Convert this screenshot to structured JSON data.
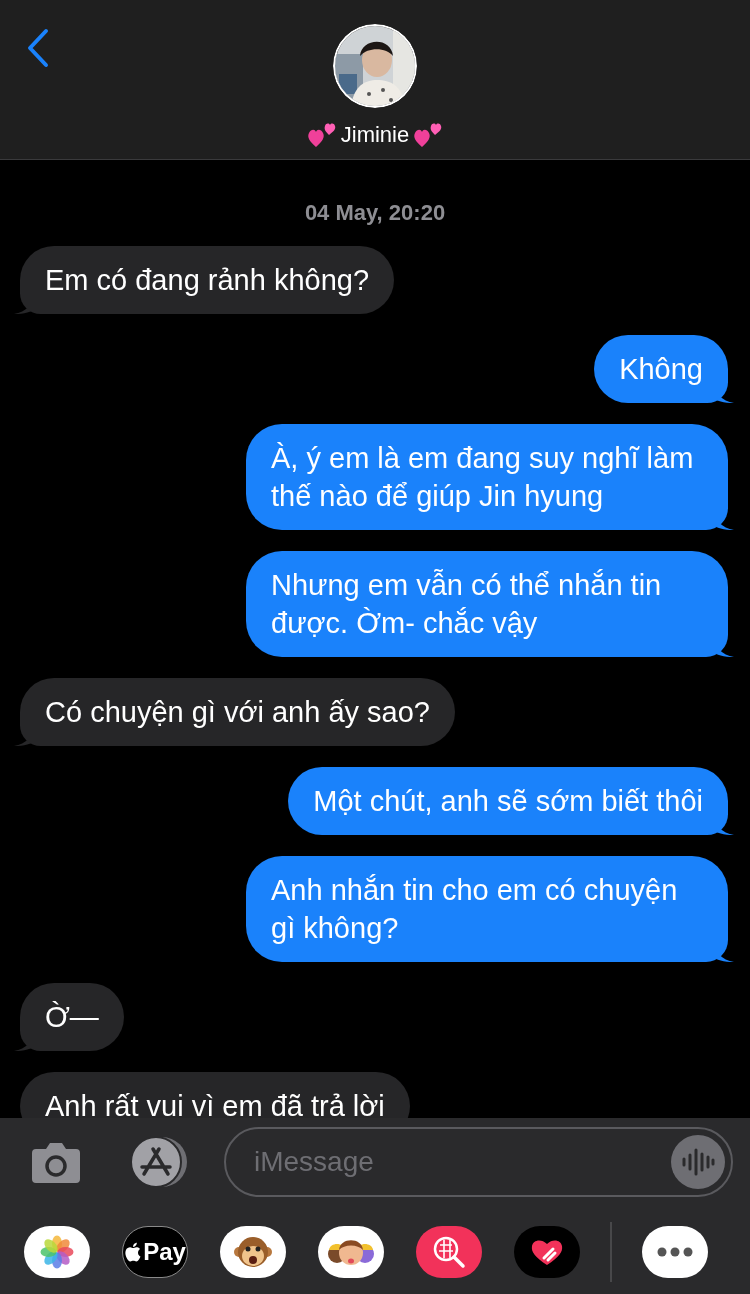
{
  "header": {
    "contact_name": "Jiminie"
  },
  "timestamp": "04 May, 20:20",
  "messages": [
    {
      "kind": "incoming",
      "tail": true,
      "text": "Em có đang rảnh không?"
    },
    {
      "kind": "outgoing",
      "tail": true,
      "text": "Không"
    },
    {
      "kind": "outgoing",
      "tail": true,
      "text": "À, ý em là em đang suy nghĩ làm thế nào để giúp Jin hyung"
    },
    {
      "kind": "outgoing",
      "tail": true,
      "text": "Nhưng em vẫn có thể nhắn tin được. Ờm- chắc vậy"
    },
    {
      "kind": "incoming",
      "tail": true,
      "text": "Có chuyện gì với anh ấy sao?"
    },
    {
      "kind": "outgoing",
      "tail": true,
      "text": "Một chút, anh sẽ sớm biết thôi"
    },
    {
      "kind": "outgoing",
      "tail": true,
      "text": "Anh nhắn tin cho em có chuyện gì không?"
    },
    {
      "kind": "incoming",
      "tail": true,
      "text": "Ờ—"
    },
    {
      "kind": "incoming",
      "tail": false,
      "text": "Anh rất vui vì em đã trả lời"
    }
  ],
  "composer": {
    "placeholder": "iMessage"
  },
  "app_drawer": [
    {
      "kind": "photos"
    },
    {
      "kind": "pay",
      "label": "Pay"
    },
    {
      "kind": "monkey"
    },
    {
      "kind": "memoji"
    },
    {
      "kind": "search"
    },
    {
      "kind": "heart"
    },
    {
      "kind": "more"
    }
  ]
}
